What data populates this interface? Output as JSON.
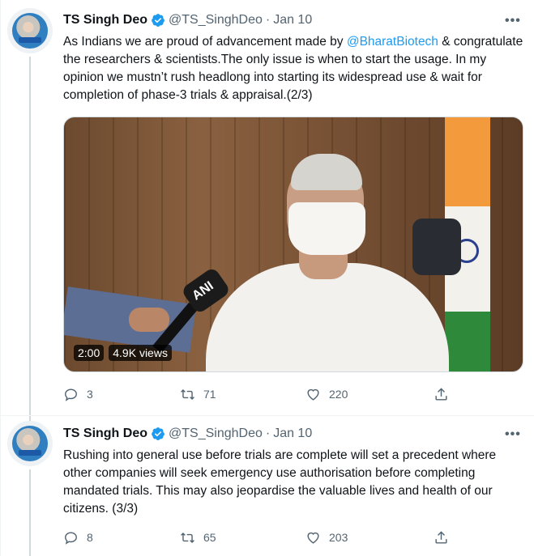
{
  "tweets": [
    {
      "display_name": "TS Singh Deo",
      "handle": "@TS_SinghDeo",
      "separator": "·",
      "date": "Jan 10",
      "more": "•••",
      "text_before": "As Indians we are proud of  advancement made by ",
      "mention": "@BharatBiotech",
      "text_after": " & congratulate the researchers & scientists.The only issue is when to start the usage. In my opinion we mustn’t rush headlong into starting its widespread use & wait for completion of phase-3 trials & appraisal.(2/3)",
      "video": {
        "duration": "2:00",
        "views": "4.9K views",
        "mic_label": "ANI"
      },
      "replies": "3",
      "retweets": "71",
      "likes": "220"
    },
    {
      "display_name": "TS Singh Deo",
      "handle": "@TS_SinghDeo",
      "separator": "·",
      "date": "Jan 10",
      "more": "•••",
      "text": "Rushing into general use before trials are complete will set a precedent where other companies will seek emergency use authorisation before completing mandated trials. This may also jeopardise the valuable lives and health of our citizens.  (3/3)",
      "replies": "8",
      "retweets": "65",
      "likes": "203"
    }
  ],
  "colors": {
    "accent": "#1d9bf0",
    "muted": "#536471",
    "text": "#0f1419"
  },
  "icons": [
    "verified-badge-icon",
    "more-icon",
    "reply-icon",
    "retweet-icon",
    "like-icon",
    "share-icon"
  ]
}
